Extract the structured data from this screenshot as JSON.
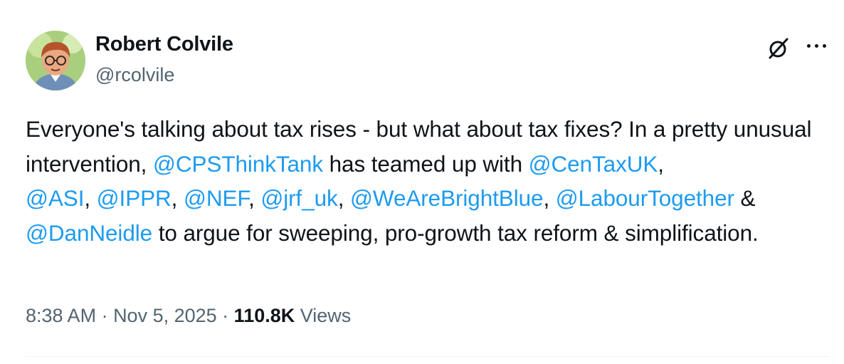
{
  "author": {
    "name": "Robert Colvile",
    "handle": "@rcolvile"
  },
  "tweet": {
    "t1": "Everyone's talking about tax rises - but what about tax fixes? In a pretty unusual intervention, ",
    "m1": "@CPSThinkTank",
    "t2": " has teamed up with ",
    "m2": "@CenTaxUK",
    "t3": ", ",
    "m3": "@ASI",
    "t4": ", ",
    "m4": "@IPPR",
    "t5": ", ",
    "m5": "@NEF",
    "t6": ", ",
    "m6": "@jrf_uk",
    "t7": ", ",
    "m7": "@WeAreBrightBlue",
    "t8": ", ",
    "m8": "@LabourTogether",
    "t9": " & ",
    "m9": "@DanNeidle",
    "t10": " to argue for sweeping, pro-growth tax reform & simplification."
  },
  "meta": {
    "time": "8:38 AM",
    "sep1": " · ",
    "date": "Nov 5, 2025",
    "sep2": " · ",
    "views_count": "110.8K",
    "views_label": " Views"
  },
  "colors": {
    "link": "#1d9bf0",
    "text": "#0f1419",
    "secondary": "#536471"
  },
  "icons": {
    "grok": "grok-icon",
    "more": "more-icon"
  }
}
